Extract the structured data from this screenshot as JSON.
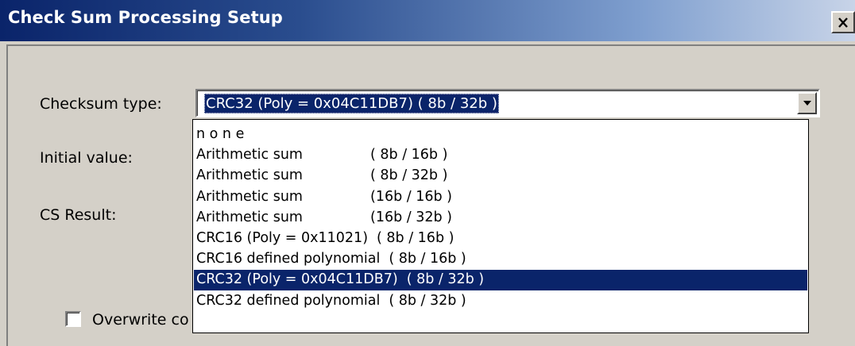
{
  "window": {
    "title": "Check Sum Processing Setup",
    "close_glyph": "X"
  },
  "form": {
    "checksum_type_label": "Checksum type:",
    "initial_value_label": "Initial value:",
    "cs_result_label": "CS Result:",
    "overwrite_label": "Overwrite co"
  },
  "combo": {
    "selected_value": "CRC32 (Poly = 0x04C11DB7) ( 8b / 32b )",
    "arrow_icon": "chevron-down-icon"
  },
  "dropdown": {
    "items": [
      {
        "name": "n o n e",
        "bits": ""
      },
      {
        "name": "Arithmetic sum",
        "bits": "( 8b / 16b )"
      },
      {
        "name": "Arithmetic sum",
        "bits": "( 8b / 32b )"
      },
      {
        "name": "Arithmetic sum",
        "bits": "(16b / 16b )"
      },
      {
        "name": "Arithmetic sum",
        "bits": "(16b / 32b )"
      },
      {
        "name": "CRC16 (Poly = 0x11021)",
        "bits": "( 8b / 16b )"
      },
      {
        "name": "CRC16 defined polynomial",
        "bits": "( 8b / 16b )"
      },
      {
        "name": "CRC32 (Poly = 0x04C11DB7)",
        "bits": "( 8b / 32b )"
      },
      {
        "name": "CRC32 defined polynomial",
        "bits": "( 8b / 32b )"
      }
    ],
    "selected_index": 7
  },
  "colors": {
    "selection": "#0a246a",
    "dialog_face": "#d4d0c8",
    "title_start": "#0a246a",
    "title_end": "#c8d4e8"
  }
}
